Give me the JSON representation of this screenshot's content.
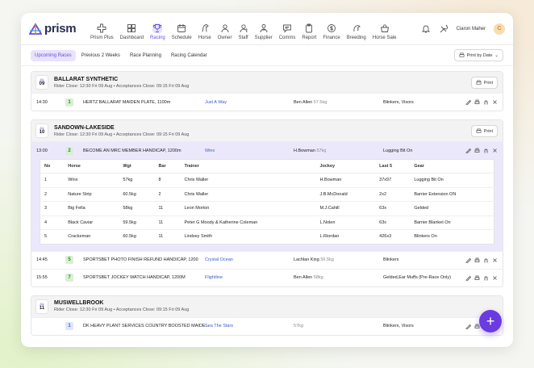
{
  "app": {
    "logo_text": "prism"
  },
  "nav": [
    {
      "label": "Prism Plus",
      "icon": "plus-cross-icon"
    },
    {
      "label": "Dashboard",
      "icon": "dashboard-icon"
    },
    {
      "label": "Racing",
      "icon": "trophy-icon",
      "active": true
    },
    {
      "label": "Schedule",
      "icon": "calendar-icon"
    },
    {
      "label": "Horse",
      "icon": "horse-icon"
    },
    {
      "label": "Owner",
      "icon": "person-icon"
    },
    {
      "label": "Staff",
      "icon": "staff-icon"
    },
    {
      "label": "Supplier",
      "icon": "supplier-icon"
    },
    {
      "label": "Comms",
      "icon": "chat-icon"
    },
    {
      "label": "Report",
      "icon": "clipboard-icon"
    },
    {
      "label": "Finance",
      "icon": "dollar-icon"
    },
    {
      "label": "Breeding",
      "icon": "breeding-icon"
    },
    {
      "label": "Horse Sale",
      "icon": "basket-icon"
    }
  ],
  "user": {
    "name": "Ciaron Maher",
    "initial": "C"
  },
  "tabs": [
    "Upcoming Races",
    "Previous 2 Weeks",
    "Race Planning",
    "Racing Calendar"
  ],
  "print_by_date": "Print by Date",
  "print_label": "Print",
  "meetings": [
    {
      "month": "JUL",
      "day": "09",
      "name": "BALLARAT SYNTHETIC",
      "sub": "Rider Close: 12:30 Fri 09 Aug  •  Acceptances Close: 09:15 Fri 09 Aug",
      "races": [
        {
          "time": "14:30",
          "num": "1",
          "name": "HERTZ BALLARAT MAIDEN PLATE, 1100m",
          "horse": "Just A Way",
          "jockey": "Ben Allen",
          "weight": "57.5kg",
          "gear": "Blinkers, Visors"
        }
      ]
    },
    {
      "month": "JUL",
      "day": "10",
      "name": "SANDOWN-LAKESIDE",
      "sub": "Rider Close: 12:30 Fri 09 Aug  •  Acceptances Close: 09:15 Fri 09 Aug",
      "expanded_race": {
        "time": "13:00",
        "num": "2",
        "name": "BECOME AN MRC MEMBER HANDICAP, 1200m",
        "horse": "Winx",
        "jockey": "H.Bowman",
        "weight": "57kg",
        "gear": "Lugging Bit On"
      },
      "detail_headers": [
        "No",
        "Horse",
        "Wgt",
        "Bar",
        "Trainer",
        "Jockey",
        "Last 5",
        "Gear"
      ],
      "detail_rows": [
        [
          "1",
          "Winx",
          "57kg",
          "8",
          "Chris Waller",
          "H.Bowman",
          "37x97",
          "Lugging Bit On"
        ],
        [
          "2",
          "Nature Strip",
          "60.5kg",
          "2",
          "Chris Waller",
          "J.B.McDonald",
          "2x2",
          "Barrier Extension ON"
        ],
        [
          "3",
          "Big Fella",
          "58kg",
          "11",
          "Leon Morton",
          "M.J.Cahill",
          "63x",
          "Gelded"
        ],
        [
          "4",
          "Black Caviar",
          "59.5kg",
          "11",
          "Peter G Moody & Katherine Coleman",
          "L.Nolen",
          "63x",
          "Barrier Blanket On"
        ],
        [
          "5",
          "Crackeman",
          "60.5kg",
          "11",
          "Lindsey Smith",
          "L.Riordan",
          "426x3",
          "Blinkers On"
        ]
      ],
      "races": [
        {
          "time": "14:45",
          "num": "5",
          "name": "SPORTSBET PHOTO FINISH REFUND HANDICAP, 1200",
          "horse": "Crystal Ocean",
          "jockey": "Lachlan King",
          "weight": "56.5kg",
          "gear": "Blinkers"
        },
        {
          "time": "15:55",
          "num": "7",
          "name": "SPORTSBET JOCKEY WATCH HANDICAP, 1200M",
          "horse": "Flightline",
          "jockey": "Ben Allen",
          "weight": "58kg",
          "gear": "Gelded,Ear Muffs (Pre-Race Only)"
        }
      ]
    },
    {
      "month": "JUL",
      "day": "11",
      "name": "MUSWELLBROOK",
      "sub": "Rider Close: 12:30 Fri 09 Aug  •  Acceptances Close: 09:15 Fri 09 Aug",
      "races": [
        {
          "time": "",
          "num": "1",
          "name": "DK HEAVY PLANT SERVICES COUNTRY BOOSTED MAIDE...",
          "horse": "Sea The Stars",
          "jockey": "",
          "weight": "57kg",
          "gear": "Blinkers, Visors"
        }
      ]
    }
  ],
  "fab_label": "+"
}
